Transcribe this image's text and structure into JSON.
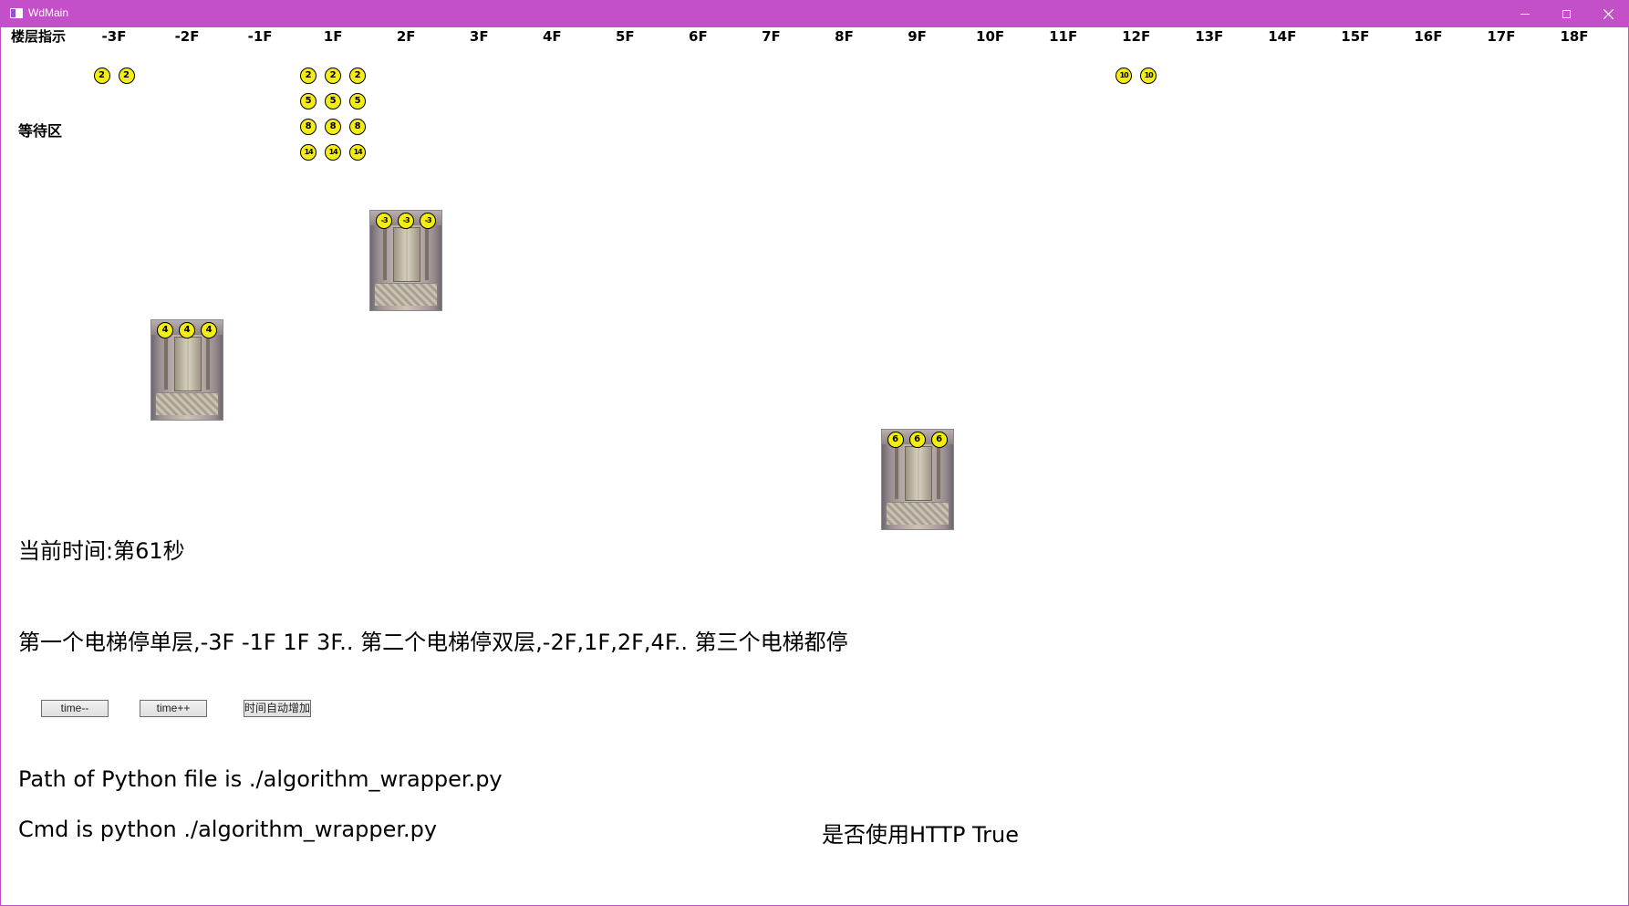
{
  "window": {
    "title": "WdMain"
  },
  "header": {
    "floor_indicator_label": "楼层指示"
  },
  "floors": [
    "-3F",
    "-2F",
    "-1F",
    "1F",
    "2F",
    "3F",
    "4F",
    "5F",
    "6F",
    "7F",
    "8F",
    "9F",
    "10F",
    "11F",
    "12F",
    "13F",
    "14F",
    "15F",
    "16F",
    "17F",
    "18F"
  ],
  "waiting_area": {
    "label": "等待区",
    "passengers": [
      {
        "floor": "-3F",
        "targets": [
          "2",
          "2"
        ]
      },
      {
        "floor": "1F",
        "targets": [
          "2",
          "2",
          "2",
          "5",
          "5",
          "5",
          "8",
          "8",
          "8",
          "14",
          "14",
          "14"
        ]
      },
      {
        "floor": "12F",
        "targets": [
          "10",
          "10"
        ]
      }
    ]
  },
  "elevators": [
    {
      "name": "elevator-1",
      "floor": "2F",
      "passengers": [
        "-3",
        "-3",
        "-3"
      ]
    },
    {
      "name": "elevator-2",
      "floor": "-2F",
      "passengers": [
        "4",
        "4",
        "4"
      ]
    },
    {
      "name": "elevator-3",
      "floor": "9F",
      "passengers": [
        "6",
        "6",
        "6"
      ]
    }
  ],
  "status": {
    "current_time": "当前时间:第61秒",
    "description": "第一个电梯停单层,-3F -1F 1F 3F.. 第二个电梯停双层,-2F,1F,2F,4F.. 第三个电梯都停"
  },
  "controls": {
    "time_dec": "time--",
    "time_inc": "time++",
    "auto_time": "时间自动增加"
  },
  "info": {
    "python_path": "Path of Python file is ./algorithm_wrapper.py",
    "cmd": "Cmd is python ./algorithm_wrapper.py",
    "http": "是否使用HTTP True"
  },
  "colors": {
    "titlebar": "#c34fc9",
    "passenger": "#f4ed12"
  }
}
